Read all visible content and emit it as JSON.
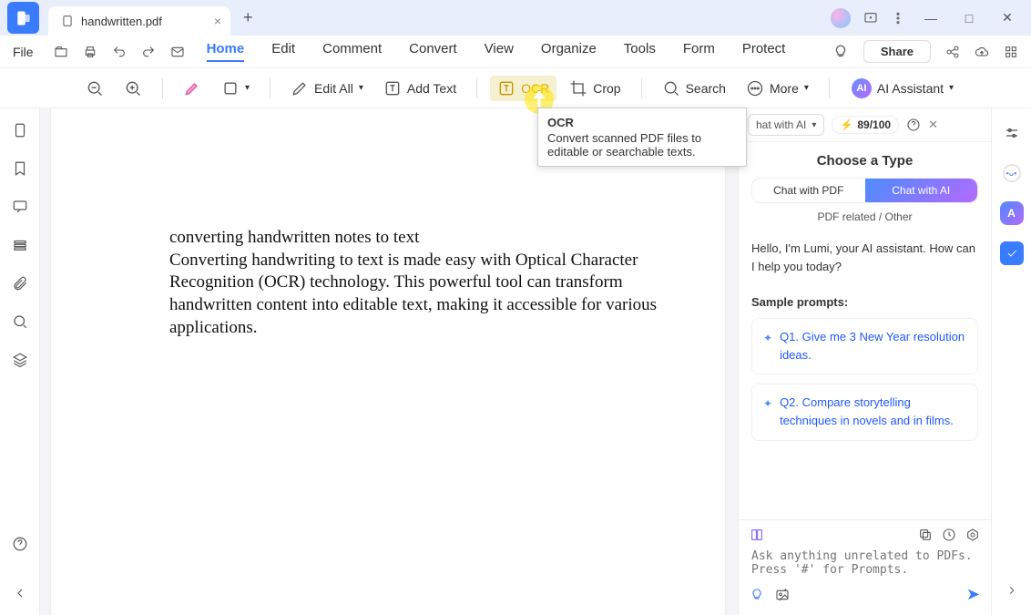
{
  "tab": {
    "title": "handwritten.pdf"
  },
  "menu": {
    "file": "File",
    "items": [
      "Home",
      "Edit",
      "Comment",
      "Convert",
      "View",
      "Organize",
      "Tools",
      "Form",
      "Protect"
    ],
    "active": "Home",
    "share": "Share"
  },
  "toolbar": {
    "edit_all": "Edit All",
    "add_text": "Add Text",
    "ocr": "OCR",
    "crop": "Crop",
    "search": "Search",
    "more": "More",
    "ai_assistant": "AI Assistant"
  },
  "tooltip": {
    "title": "OCR",
    "body": "Convert scanned PDF files to editable or searchable texts."
  },
  "document": {
    "text": "converting handwritten notes to text\nConverting handwriting to text is made easy with Optical Character Recognition (OCR) technology. This powerful tool can transform handwritten content into editable text, making it accessible for various applications."
  },
  "ai_panel": {
    "selector": "hat with AI",
    "credits": "89/100",
    "choose_title": "Choose a Type",
    "tab_pdf": "Chat with PDF",
    "tab_ai": "Chat with AI",
    "subtext": "PDF related / Other",
    "greeting": "Hello, I'm Lumi, your AI assistant. How can I help you today?",
    "prompts_title": "Sample prompts:",
    "q1": "Q1. Give me 3 New Year resolution ideas.",
    "q2": "Q2. Compare storytelling techniques in novels and in films.",
    "input_placeholder": "Ask anything unrelated to PDFs. Press '#' for Prompts."
  }
}
